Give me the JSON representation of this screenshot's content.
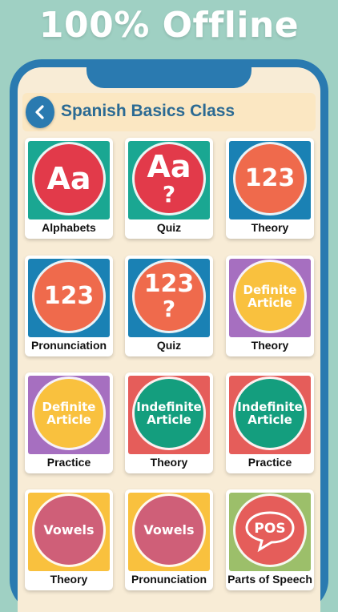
{
  "banner": {
    "headline": "100% Offline"
  },
  "header": {
    "title": "Spanish Basics Class",
    "back_icon": "chevron-left-icon"
  },
  "colors": {
    "red": "#e23a4a",
    "teal": "#1aa792",
    "blue": "#1a81b4",
    "orange": "#ef6a4c",
    "purple": "#a66fc0",
    "yellow": "#f9c13e",
    "coral": "#e55d5a",
    "green": "#149e7e",
    "mauve": "#cf5f78",
    "olive": "#9cbf6a"
  },
  "cards": [
    {
      "label": "Alphabets",
      "icon": [
        "Aa"
      ],
      "bg": "#1aa792",
      "circle": "#e23a4a",
      "style": "big"
    },
    {
      "label": "Quiz",
      "icon": [
        "Aa",
        "?"
      ],
      "bg": "#1aa792",
      "circle": "#e23a4a",
      "style": "q"
    },
    {
      "label": "Theory",
      "icon": [
        "123"
      ],
      "bg": "#1a81b4",
      "circle": "#ef6a4c",
      "style": "num"
    },
    {
      "label": "Pronunciation",
      "icon": [
        "123"
      ],
      "bg": "#1a81b4",
      "circle": "#ef6a4c",
      "style": "num"
    },
    {
      "label": "Quiz",
      "icon": [
        "123",
        "?"
      ],
      "bg": "#1a81b4",
      "circle": "#ef6a4c",
      "style": "q"
    },
    {
      "label": "Theory",
      "icon": [
        "Definite",
        "Article"
      ],
      "bg": "#a66fc0",
      "circle": "#f9c13e",
      "style": "two"
    },
    {
      "label": "Practice",
      "icon": [
        "Definite",
        "Article"
      ],
      "bg": "#a66fc0",
      "circle": "#f9c13e",
      "style": "two"
    },
    {
      "label": "Theory",
      "icon": [
        "Indefinite",
        "Article"
      ],
      "bg": "#e55d5a",
      "circle": "#149e7e",
      "style": "two"
    },
    {
      "label": "Practice",
      "icon": [
        "Indefinite",
        "Article"
      ],
      "bg": "#e55d5a",
      "circle": "#149e7e",
      "style": "two"
    },
    {
      "label": "Theory",
      "icon": [
        "Vowels"
      ],
      "bg": "#f9c13e",
      "circle": "#cf5f78",
      "style": "v"
    },
    {
      "label": "Pronunciation",
      "icon": [
        "Vowels"
      ],
      "bg": "#f9c13e",
      "circle": "#cf5f78",
      "style": "v"
    },
    {
      "label": "Parts of Speech",
      "icon": [
        "POS"
      ],
      "bg": "#9cbf6a",
      "circle": "#e55d5a",
      "style": "pos"
    }
  ]
}
